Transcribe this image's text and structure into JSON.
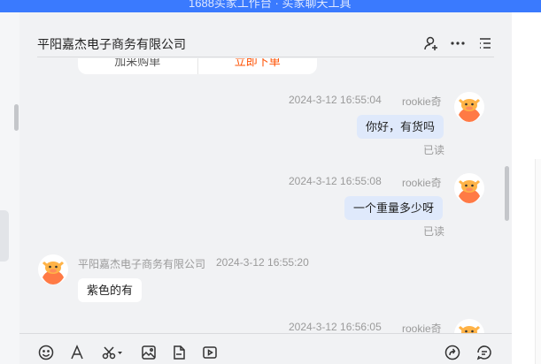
{
  "banner": {
    "text": "1688买家工作台 · 买家聊天工具"
  },
  "chat": {
    "title": "平阳嘉杰电子商务有限公司",
    "card": {
      "left_label": "加采购单",
      "right_label": "立即下单"
    },
    "messages": [
      {
        "sender": "rookie奇",
        "time": "2024-3-12 16:55:04",
        "text": "你好，有货吗",
        "status": "已读"
      },
      {
        "sender": "rookie奇",
        "time": "2024-3-12 16:55:08",
        "text": "一个重量多少呀",
        "status": "已读"
      },
      {
        "sender": "平阳嘉杰电子商务有限公司",
        "time": "2024-3-12 16:55:20",
        "text": "紫色的有"
      },
      {
        "sender": "rookie奇",
        "time": "2024-3-12 16:56:05"
      }
    ]
  },
  "icons": {
    "header": [
      "user-plus-icon",
      "more-icon",
      "list-icon"
    ],
    "toolbar": [
      "emoji-icon",
      "font-icon",
      "scissors-icon",
      "image-icon",
      "file-icon",
      "video-icon",
      "share-icon",
      "message-settings-icon"
    ]
  },
  "colors": {
    "accent": "#3a7afe",
    "my_bubble": "#dfe9fb",
    "their_bubble": "#ffffff",
    "order_button": "#ff5000"
  }
}
